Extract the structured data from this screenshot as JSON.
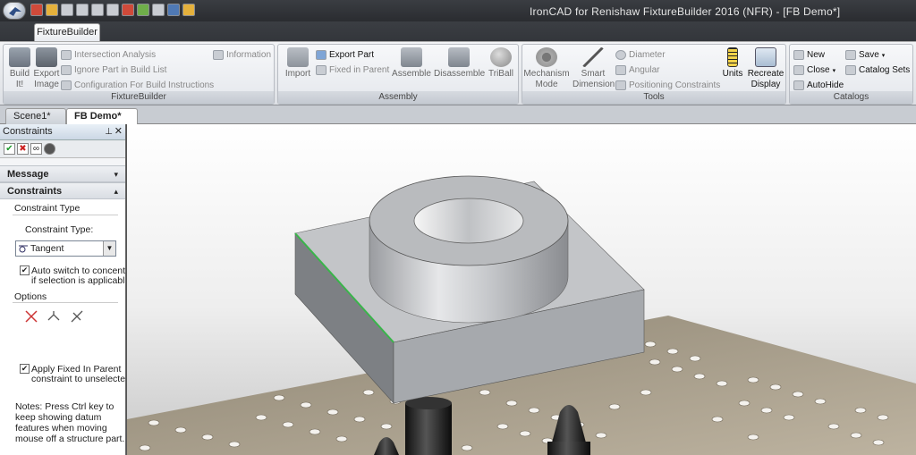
{
  "window": {
    "title": "IronCAD for Renishaw FixtureBuilder 2016 (NFR) - [FB Demo*]"
  },
  "ribbon": {
    "active_tab": "FixtureBuilder",
    "groups": {
      "fixturebuilder": {
        "label": "FixtureBuilder",
        "build": "Build It!",
        "export_image": "Export Image",
        "intersection": "Intersection Analysis",
        "ignore_part": "Ignore Part in Build List",
        "configuration": "Configuration For Build Instructions",
        "information": "Information"
      },
      "assembly": {
        "label": "Assembly",
        "import": "Import",
        "export_part": "Export Part",
        "fixed_in_parent": "Fixed in Parent",
        "assemble": "Assemble",
        "disassemble": "Disassemble",
        "triball": "TriBall"
      },
      "tools": {
        "label": "Tools",
        "mechanism_mode": "Mechanism Mode",
        "smart_dimension": "Smart Dimension",
        "diameter": "Diameter",
        "angular": "Angular",
        "positioning": "Positioning Constraints",
        "units": "Units",
        "recreate_display": "Recreate Display"
      },
      "catalogs": {
        "label": "Catalogs",
        "new": "New",
        "save": "Save",
        "close": "Close",
        "catalog_sets": "Catalog Sets",
        "autohide": "AutoHide"
      }
    }
  },
  "doc_tabs": [
    {
      "label": "Scene1*",
      "active": false
    },
    {
      "label": "FB Demo*",
      "active": true
    }
  ],
  "panel": {
    "title": "Constraints",
    "message_header": "Message",
    "constraints_header": "Constraints",
    "constraint_type_group": "Constraint Type",
    "constraint_type_label": "Constraint Type:",
    "constraint_type_value": "Tangent",
    "auto_switch_line1": "Auto switch to concentric",
    "auto_switch_line2": "if selection is applicable",
    "options_label": "Options",
    "apply_fixed_line1": "Apply Fixed In Parent",
    "apply_fixed_line2": "constraint to unselected",
    "notes_lines": [
      "Notes: Press Ctrl key to",
      "keep showing datum",
      "features when moving",
      "mouse off a structure part."
    ]
  },
  "colors": {
    "edge_highlight": "#39b54a",
    "panel_header": "#cbd7e4"
  }
}
